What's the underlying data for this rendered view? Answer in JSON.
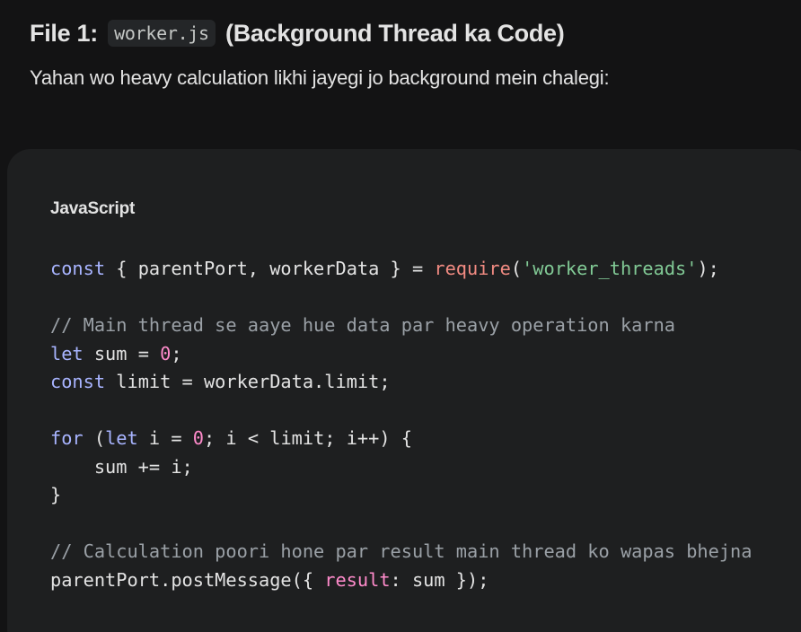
{
  "heading": {
    "prefix": "File 1:",
    "filename": "worker.js",
    "suffix": "(Background Thread ka Code)"
  },
  "intro": "Yahan wo heavy calculation likhi jayegi jo background mein chalegi:",
  "code": {
    "language": "JavaScript",
    "lines": [
      [
        {
          "t": "const",
          "c": "kw"
        },
        {
          "t": " { parentPort, workerData } = "
        },
        {
          "t": "require",
          "c": "fn"
        },
        {
          "t": "("
        },
        {
          "t": "'worker_threads'",
          "c": "str"
        },
        {
          "t": ");"
        }
      ],
      [],
      [
        {
          "t": "// Main thread se aaye hue data par heavy operation karna",
          "c": "cm"
        }
      ],
      [
        {
          "t": "let",
          "c": "kw"
        },
        {
          "t": " sum = "
        },
        {
          "t": "0",
          "c": "num"
        },
        {
          "t": ";"
        }
      ],
      [
        {
          "t": "const",
          "c": "kw"
        },
        {
          "t": " limit = workerData.limit;"
        }
      ],
      [],
      [
        {
          "t": "for",
          "c": "kw"
        },
        {
          "t": " ("
        },
        {
          "t": "let",
          "c": "kw"
        },
        {
          "t": " i = "
        },
        {
          "t": "0",
          "c": "num"
        },
        {
          "t": "; i < limit; i++) {"
        }
      ],
      [
        {
          "t": "    sum += i;"
        }
      ],
      [
        {
          "t": "}"
        }
      ],
      [],
      [
        {
          "t": "// Calculation poori hone par result main thread ko wapas bhejna",
          "c": "cm"
        }
      ],
      [
        {
          "t": "parentPort.postMessage({ "
        },
        {
          "t": "result",
          "c": "prop"
        },
        {
          "t": ": sum });"
        }
      ]
    ]
  },
  "colors": {
    "background": "#131314",
    "card": "#1e1f20",
    "keyword": "#a8b4ff",
    "function": "#f28b82",
    "string": "#81c995",
    "number": "#ff8bcb",
    "comment": "#9aa0a6"
  }
}
